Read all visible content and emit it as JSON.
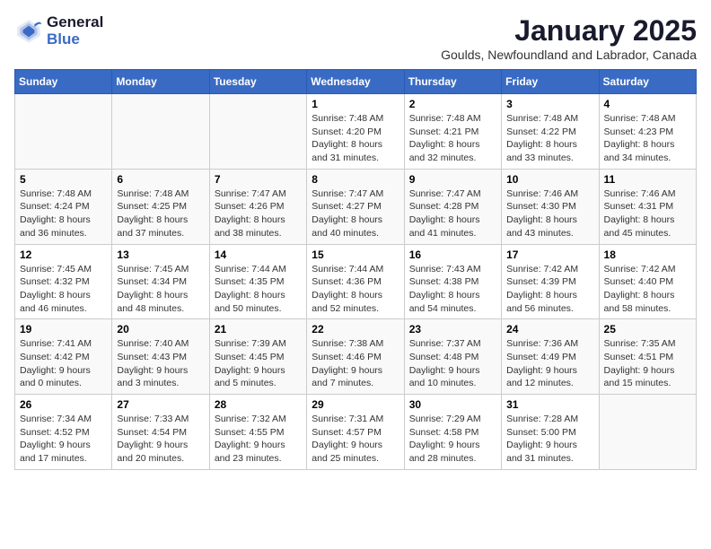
{
  "header": {
    "logo_line1": "General",
    "logo_line2": "Blue",
    "month": "January 2025",
    "location": "Goulds, Newfoundland and Labrador, Canada"
  },
  "weekdays": [
    "Sunday",
    "Monday",
    "Tuesday",
    "Wednesday",
    "Thursday",
    "Friday",
    "Saturday"
  ],
  "weeks": [
    [
      {
        "day": "",
        "sunrise": "",
        "sunset": "",
        "daylight": ""
      },
      {
        "day": "",
        "sunrise": "",
        "sunset": "",
        "daylight": ""
      },
      {
        "day": "",
        "sunrise": "",
        "sunset": "",
        "daylight": ""
      },
      {
        "day": "1",
        "sunrise": "Sunrise: 7:48 AM",
        "sunset": "Sunset: 4:20 PM",
        "daylight": "Daylight: 8 hours and 31 minutes."
      },
      {
        "day": "2",
        "sunrise": "Sunrise: 7:48 AM",
        "sunset": "Sunset: 4:21 PM",
        "daylight": "Daylight: 8 hours and 32 minutes."
      },
      {
        "day": "3",
        "sunrise": "Sunrise: 7:48 AM",
        "sunset": "Sunset: 4:22 PM",
        "daylight": "Daylight: 8 hours and 33 minutes."
      },
      {
        "day": "4",
        "sunrise": "Sunrise: 7:48 AM",
        "sunset": "Sunset: 4:23 PM",
        "daylight": "Daylight: 8 hours and 34 minutes."
      }
    ],
    [
      {
        "day": "5",
        "sunrise": "Sunrise: 7:48 AM",
        "sunset": "Sunset: 4:24 PM",
        "daylight": "Daylight: 8 hours and 36 minutes."
      },
      {
        "day": "6",
        "sunrise": "Sunrise: 7:48 AM",
        "sunset": "Sunset: 4:25 PM",
        "daylight": "Daylight: 8 hours and 37 minutes."
      },
      {
        "day": "7",
        "sunrise": "Sunrise: 7:47 AM",
        "sunset": "Sunset: 4:26 PM",
        "daylight": "Daylight: 8 hours and 38 minutes."
      },
      {
        "day": "8",
        "sunrise": "Sunrise: 7:47 AM",
        "sunset": "Sunset: 4:27 PM",
        "daylight": "Daylight: 8 hours and 40 minutes."
      },
      {
        "day": "9",
        "sunrise": "Sunrise: 7:47 AM",
        "sunset": "Sunset: 4:28 PM",
        "daylight": "Daylight: 8 hours and 41 minutes."
      },
      {
        "day": "10",
        "sunrise": "Sunrise: 7:46 AM",
        "sunset": "Sunset: 4:30 PM",
        "daylight": "Daylight: 8 hours and 43 minutes."
      },
      {
        "day": "11",
        "sunrise": "Sunrise: 7:46 AM",
        "sunset": "Sunset: 4:31 PM",
        "daylight": "Daylight: 8 hours and 45 minutes."
      }
    ],
    [
      {
        "day": "12",
        "sunrise": "Sunrise: 7:45 AM",
        "sunset": "Sunset: 4:32 PM",
        "daylight": "Daylight: 8 hours and 46 minutes."
      },
      {
        "day": "13",
        "sunrise": "Sunrise: 7:45 AM",
        "sunset": "Sunset: 4:34 PM",
        "daylight": "Daylight: 8 hours and 48 minutes."
      },
      {
        "day": "14",
        "sunrise": "Sunrise: 7:44 AM",
        "sunset": "Sunset: 4:35 PM",
        "daylight": "Daylight: 8 hours and 50 minutes."
      },
      {
        "day": "15",
        "sunrise": "Sunrise: 7:44 AM",
        "sunset": "Sunset: 4:36 PM",
        "daylight": "Daylight: 8 hours and 52 minutes."
      },
      {
        "day": "16",
        "sunrise": "Sunrise: 7:43 AM",
        "sunset": "Sunset: 4:38 PM",
        "daylight": "Daylight: 8 hours and 54 minutes."
      },
      {
        "day": "17",
        "sunrise": "Sunrise: 7:42 AM",
        "sunset": "Sunset: 4:39 PM",
        "daylight": "Daylight: 8 hours and 56 minutes."
      },
      {
        "day": "18",
        "sunrise": "Sunrise: 7:42 AM",
        "sunset": "Sunset: 4:40 PM",
        "daylight": "Daylight: 8 hours and 58 minutes."
      }
    ],
    [
      {
        "day": "19",
        "sunrise": "Sunrise: 7:41 AM",
        "sunset": "Sunset: 4:42 PM",
        "daylight": "Daylight: 9 hours and 0 minutes."
      },
      {
        "day": "20",
        "sunrise": "Sunrise: 7:40 AM",
        "sunset": "Sunset: 4:43 PM",
        "daylight": "Daylight: 9 hours and 3 minutes."
      },
      {
        "day": "21",
        "sunrise": "Sunrise: 7:39 AM",
        "sunset": "Sunset: 4:45 PM",
        "daylight": "Daylight: 9 hours and 5 minutes."
      },
      {
        "day": "22",
        "sunrise": "Sunrise: 7:38 AM",
        "sunset": "Sunset: 4:46 PM",
        "daylight": "Daylight: 9 hours and 7 minutes."
      },
      {
        "day": "23",
        "sunrise": "Sunrise: 7:37 AM",
        "sunset": "Sunset: 4:48 PM",
        "daylight": "Daylight: 9 hours and 10 minutes."
      },
      {
        "day": "24",
        "sunrise": "Sunrise: 7:36 AM",
        "sunset": "Sunset: 4:49 PM",
        "daylight": "Daylight: 9 hours and 12 minutes."
      },
      {
        "day": "25",
        "sunrise": "Sunrise: 7:35 AM",
        "sunset": "Sunset: 4:51 PM",
        "daylight": "Daylight: 9 hours and 15 minutes."
      }
    ],
    [
      {
        "day": "26",
        "sunrise": "Sunrise: 7:34 AM",
        "sunset": "Sunset: 4:52 PM",
        "daylight": "Daylight: 9 hours and 17 minutes."
      },
      {
        "day": "27",
        "sunrise": "Sunrise: 7:33 AM",
        "sunset": "Sunset: 4:54 PM",
        "daylight": "Daylight: 9 hours and 20 minutes."
      },
      {
        "day": "28",
        "sunrise": "Sunrise: 7:32 AM",
        "sunset": "Sunset: 4:55 PM",
        "daylight": "Daylight: 9 hours and 23 minutes."
      },
      {
        "day": "29",
        "sunrise": "Sunrise: 7:31 AM",
        "sunset": "Sunset: 4:57 PM",
        "daylight": "Daylight: 9 hours and 25 minutes."
      },
      {
        "day": "30",
        "sunrise": "Sunrise: 7:29 AM",
        "sunset": "Sunset: 4:58 PM",
        "daylight": "Daylight: 9 hours and 28 minutes."
      },
      {
        "day": "31",
        "sunrise": "Sunrise: 7:28 AM",
        "sunset": "Sunset: 5:00 PM",
        "daylight": "Daylight: 9 hours and 31 minutes."
      },
      {
        "day": "",
        "sunrise": "",
        "sunset": "",
        "daylight": ""
      }
    ]
  ]
}
